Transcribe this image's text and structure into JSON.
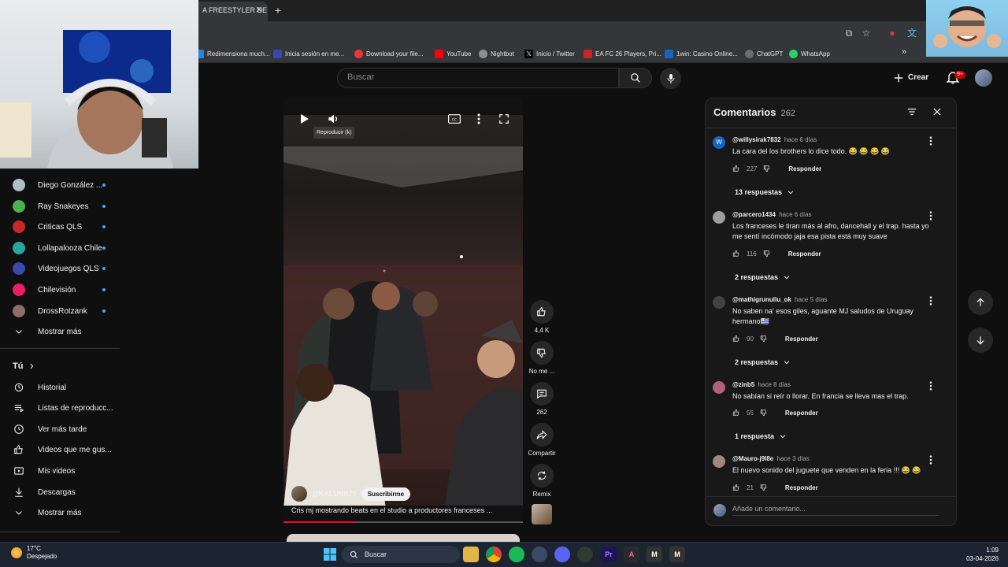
{
  "browser": {
    "active_tab_title": "A FREESTYLER DE",
    "bookmarks": [
      {
        "label": "Redimensiona much...",
        "color": "#1e88e5"
      },
      {
        "label": "Inicia sesión en me...",
        "color": "#3949ab"
      },
      {
        "label": "Download your file...",
        "color": "#e53935"
      },
      {
        "label": "YouTube",
        "color": "#ff0000"
      },
      {
        "label": "Nightbot",
        "color": "#8e8e8e"
      },
      {
        "label": "Inicio / Twitter",
        "color": "#000000"
      },
      {
        "label": "EA FC 26 Players, Pri...",
        "color": "#c62828"
      },
      {
        "label": "1win: Casino Online...",
        "color": "#1565c0"
      },
      {
        "label": "ChatGPT",
        "color": "#6d6d6d"
      },
      {
        "label": "WhatsApp",
        "color": "#25d366"
      }
    ]
  },
  "header": {
    "search_placeholder": "Buscar",
    "create_label": "Crear",
    "notifications_badge": "9+"
  },
  "sidebar": {
    "subscriptions": [
      {
        "label": "Diego González ...",
        "avatar_color": "#b0bec5"
      },
      {
        "label": "Ray Snakeyes",
        "avatar_color": "#4caf50"
      },
      {
        "label": "Criticas QLS",
        "avatar_color": "#c62828"
      },
      {
        "label": "Lollapalooza Chile",
        "avatar_color": "#26a69a"
      },
      {
        "label": "Videojuegos QLS",
        "avatar_color": "#3949ab"
      },
      {
        "label": "Chilevisión",
        "avatar_color": "#e91e63"
      },
      {
        "label": "DrossRotzank",
        "avatar_color": "#8d6e63"
      }
    ],
    "show_more_1": "Mostrar más",
    "you_section": "Tú",
    "you_items": [
      {
        "label": "Historial",
        "icon": "history-icon"
      },
      {
        "label": "Listas de reproducc...",
        "icon": "playlist-icon"
      },
      {
        "label": "Ver más tarde",
        "icon": "clock-icon"
      },
      {
        "label": "Videos que me gus...",
        "icon": "like-icon"
      },
      {
        "label": "Mis videos",
        "icon": "video-icon"
      },
      {
        "label": "Descargas",
        "icon": "download-icon"
      }
    ],
    "show_more_2": "Mostrar más"
  },
  "video": {
    "tooltip": "Reproducir (k)",
    "channel_handle": "@KALUNB25",
    "subscribe_label": "Suscribirme",
    "caption": "Cris mj mostrando beats en el studio a productores franceses ...",
    "progress": 0.3
  },
  "actions": {
    "likes": "4,4 K",
    "dislike": "No me ...",
    "comments": "262",
    "share": "Compartir",
    "remix": "Remix"
  },
  "comments": {
    "title": "Comentarios",
    "count": "262",
    "reply_label": "Responder",
    "add_placeholder": "Añade un comentario...",
    "items": [
      {
        "user": "@willysirak7832",
        "time": "hace 6 días",
        "text": "La cara del los brothers lo dice todo. 😂 😂 😂 😂",
        "likes": "227",
        "replies": "13 respuestas",
        "avatar_letter": "W",
        "avatar_color": "#1565c0"
      },
      {
        "user": "@parcero1434",
        "time": "hace 6 días",
        "text": "Los franceses le tiran más al afro, dancehall y el trap. hasta yo me sentí incómodo jaja esa pista está muy suave",
        "likes": "116",
        "replies": "2 respuestas",
        "avatar_letter": "",
        "avatar_color": "#9e9e9e"
      },
      {
        "user": "@mathigrunullu_ok",
        "time": "hace 5 días",
        "text": "No saben na' esos giles, aguante MJ saludos de Uruguay hermano🇺🇾",
        "likes": "90",
        "replies": "2 respuestas",
        "avatar_letter": "",
        "avatar_color": "#424242"
      },
      {
        "user": "@zinb5",
        "time": "hace 8 días",
        "text": "No sabían si reír o llorar. En francia se lleva mas el trap.",
        "likes": "55",
        "replies": "1 respuesta",
        "avatar_letter": "",
        "avatar_color": "#b0607a"
      },
      {
        "user": "@Mauro-j9l8e",
        "time": "hace 3 días",
        "text": "El nuevo sonido del juguete que venden en la feria !!! 😂 😂",
        "likes": "21",
        "replies": "",
        "avatar_letter": "",
        "avatar_color": "#a1887f"
      }
    ]
  },
  "taskbar": {
    "temperature": "17°C",
    "weather": "Despejado",
    "search_label": "Buscar",
    "time": "1:09",
    "date": "03-04-2026"
  },
  "colors": {
    "accent_red": "#ff0033",
    "link_blue": "#3ea6ff"
  }
}
